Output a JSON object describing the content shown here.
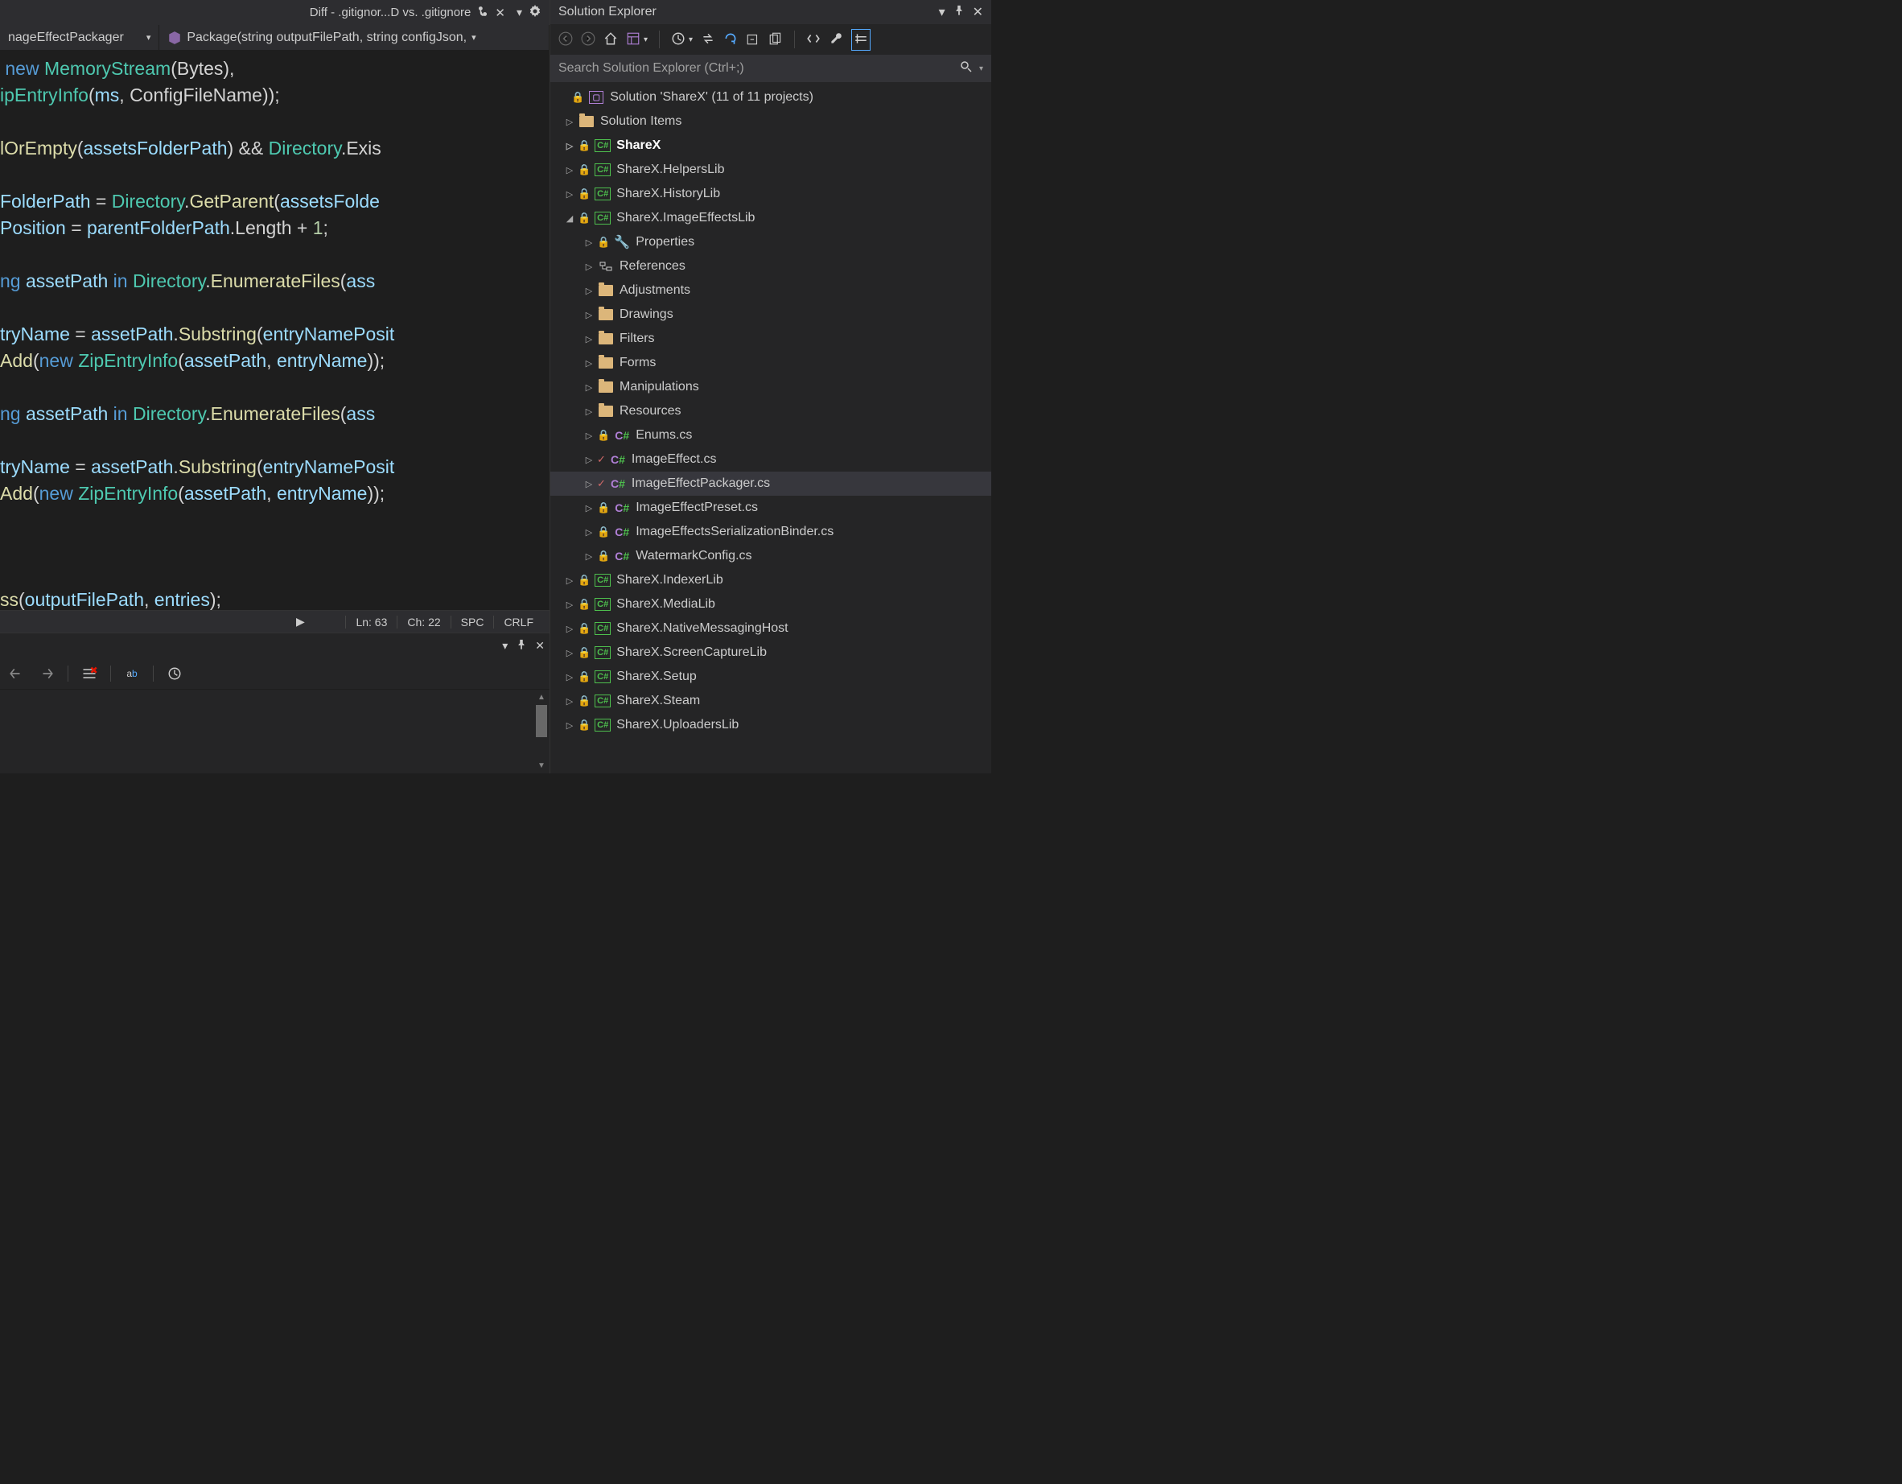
{
  "tabBar": {
    "tabTitle": "Diff - .gitignor...D vs. .gitignore"
  },
  "navBar": {
    "left": "nageEffectPackager",
    "right": "Package(string outputFilePath, string configJson,"
  },
  "code": [
    {
      "html": " <span class='k'>new</span> <span class='t'>MemoryStream</span><span class='p'>(Bytes),</span>"
    },
    {
      "html": "<span class='t'>ipEntryInfo</span><span class='p'>(</span><span class='v'>ms</span><span class='p'>, ConfigFileName));</span>"
    },
    {
      "html": ""
    },
    {
      "html": "<span class='m'>lOrEmpty</span><span class='p'>(</span><span class='v'>assetsFolderPath</span><span class='p'>) && </span><span class='t'>Directory</span><span class='p'>.Exis</span>"
    },
    {
      "html": ""
    },
    {
      "html": "<span class='v'>FolderPath</span> <span class='p'>=</span> <span class='t'>Directory</span><span class='p'>.</span><span class='m'>GetParent</span><span class='p'>(</span><span class='v'>assetsFolde</span>"
    },
    {
      "html": "<span class='v'>Position</span> <span class='p'>=</span> <span class='v'>parentFolderPath</span><span class='p'>.Length + </span><span class='n'>1</span><span class='p'>;</span>"
    },
    {
      "html": ""
    },
    {
      "html": "<span class='k'>ng</span> <span class='v'>assetPath</span> <span class='k'>in</span> <span class='t'>Directory</span><span class='p'>.</span><span class='m'>EnumerateFiles</span><span class='p'>(</span><span class='v'>ass</span>"
    },
    {
      "html": ""
    },
    {
      "html": "<span class='v'>tryName</span> <span class='p'>=</span> <span class='v'>assetPath</span><span class='p'>.</span><span class='m'>Substring</span><span class='p'>(</span><span class='v'>entryNamePosit</span>"
    },
    {
      "html": "<span class='m'>Add</span><span class='p'>(</span><span class='k'>new</span> <span class='t'>ZipEntryInfo</span><span class='p'>(</span><span class='v'>assetPath</span><span class='p'>, </span><span class='v'>entryName</span><span class='p'>));</span>"
    },
    {
      "html": ""
    },
    {
      "html": "<span class='k'>ng</span> <span class='v'>assetPath</span> <span class='k'>in</span> <span class='t'>Directory</span><span class='p'>.</span><span class='m'>EnumerateFiles</span><span class='p'>(</span><span class='v'>ass</span>"
    },
    {
      "html": ""
    },
    {
      "html": "<span class='v'>tryName</span> <span class='p'>=</span> <span class='v'>assetPath</span><span class='p'>.</span><span class='m'>Substring</span><span class='p'>(</span><span class='v'>entryNamePosit</span>"
    },
    {
      "html": "<span class='m'>Add</span><span class='p'>(</span><span class='k'>new</span> <span class='t'>ZipEntryInfo</span><span class='p'>(</span><span class='v'>assetPath</span><span class='p'>, </span><span class='v'>entryName</span><span class='p'>));</span>"
    },
    {
      "html": ""
    },
    {
      "html": ""
    },
    {
      "html": ""
    },
    {
      "html": "<span class='m'>ss</span><span class='p'>(</span><span class='v'>outputFilePath</span><span class='p'>, </span><span class='v'>entries</span><span class='p'>);</span>"
    }
  ],
  "status": {
    "ln": "Ln: 63",
    "ch": "Ch: 22",
    "spc": "SPC",
    "crlf": "CRLF"
  },
  "explorer": {
    "title": "Solution Explorer",
    "searchPlaceholder": "Search Solution Explorer (Ctrl+;)",
    "root": "Solution 'ShareX' (11 of 11 projects)",
    "items": [
      {
        "ind": 1,
        "chev": "▷",
        "lock": false,
        "type": "folder",
        "label": "Solution Items"
      },
      {
        "ind": 1,
        "chev": "▷",
        "lock": true,
        "type": "csh",
        "label": "ShareX",
        "bold": true
      },
      {
        "ind": 1,
        "chev": "▷",
        "lock": true,
        "type": "csh",
        "label": "ShareX.HelpersLib"
      },
      {
        "ind": 1,
        "chev": "▷",
        "lock": true,
        "type": "csh",
        "label": "ShareX.HistoryLib"
      },
      {
        "ind": 1,
        "chev": "◢",
        "lock": true,
        "type": "csh",
        "label": "ShareX.ImageEffectsLib"
      },
      {
        "ind": 2,
        "chev": "▷",
        "lock": true,
        "type": "wrench",
        "label": "Properties"
      },
      {
        "ind": 2,
        "chev": "▷",
        "lock": false,
        "type": "refs",
        "label": "References"
      },
      {
        "ind": 2,
        "chev": "▷",
        "lock": false,
        "type": "folder",
        "label": "Adjustments"
      },
      {
        "ind": 2,
        "chev": "▷",
        "lock": false,
        "type": "folder",
        "label": "Drawings"
      },
      {
        "ind": 2,
        "chev": "▷",
        "lock": false,
        "type": "folder",
        "label": "Filters"
      },
      {
        "ind": 2,
        "chev": "▷",
        "lock": false,
        "type": "folder",
        "label": "Forms"
      },
      {
        "ind": 2,
        "chev": "▷",
        "lock": false,
        "type": "folder",
        "label": "Manipulations"
      },
      {
        "ind": 2,
        "chev": "▷",
        "lock": false,
        "type": "folder",
        "label": "Resources"
      },
      {
        "ind": 2,
        "chev": "▷",
        "lock": true,
        "type": "cs",
        "label": "Enums.cs"
      },
      {
        "ind": 2,
        "chev": "▷",
        "check": true,
        "type": "cs",
        "label": "ImageEffect.cs"
      },
      {
        "ind": 2,
        "chev": "▷",
        "check": true,
        "type": "cs",
        "label": "ImageEffectPackager.cs",
        "sel": true
      },
      {
        "ind": 2,
        "chev": "▷",
        "lock": true,
        "type": "cs",
        "label": "ImageEffectPreset.cs"
      },
      {
        "ind": 2,
        "chev": "▷",
        "lock": true,
        "type": "cs",
        "label": "ImageEffectsSerializationBinder.cs"
      },
      {
        "ind": 2,
        "chev": "▷",
        "lock": true,
        "type": "cs",
        "label": "WatermarkConfig.cs"
      },
      {
        "ind": 1,
        "chev": "▷",
        "lock": true,
        "type": "csh",
        "label": "ShareX.IndexerLib"
      },
      {
        "ind": 1,
        "chev": "▷",
        "lock": true,
        "type": "csh",
        "label": "ShareX.MediaLib"
      },
      {
        "ind": 1,
        "chev": "▷",
        "lock": true,
        "type": "csh",
        "label": "ShareX.NativeMessagingHost"
      },
      {
        "ind": 1,
        "chev": "▷",
        "lock": true,
        "type": "csh",
        "label": "ShareX.ScreenCaptureLib"
      },
      {
        "ind": 1,
        "chev": "▷",
        "lock": true,
        "type": "csh",
        "label": "ShareX.Setup"
      },
      {
        "ind": 1,
        "chev": "▷",
        "lock": true,
        "type": "csh",
        "label": "ShareX.Steam"
      },
      {
        "ind": 1,
        "chev": "▷",
        "lock": true,
        "type": "csh",
        "label": "ShareX.UploadersLib"
      }
    ]
  }
}
